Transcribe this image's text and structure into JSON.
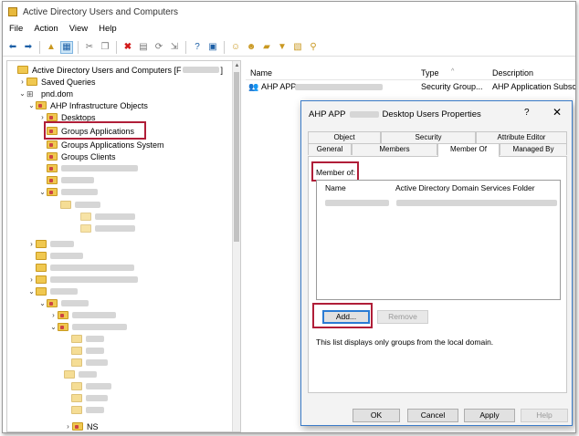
{
  "window": {
    "title": "Active Directory Users and Computers"
  },
  "menu": [
    "File",
    "Action",
    "View",
    "Help"
  ],
  "toolbar": {
    "icons": [
      "back-arrow",
      "forward-arrow",
      "up-folder",
      "console-tree",
      "cut",
      "copy",
      "delete",
      "properties",
      "refresh",
      "export",
      "help",
      "show-pane",
      "users",
      "user-add",
      "group-add",
      "filter",
      "add-to-group",
      "find"
    ]
  },
  "tree": {
    "root": "Active Directory Users and Computers [F",
    "saved_queries": "Saved Queries",
    "domain": "pnd.dom",
    "infra": "AHP Infrastructure Objects",
    "desktops": "Desktops",
    "groups_applications": "Groups Applications",
    "groups_applications_system": "Groups Applications System",
    "groups_clients": "Groups Clients",
    "ns": "NS"
  },
  "list": {
    "col_name": "Name",
    "col_type": "Type",
    "col_description": "Description",
    "row": {
      "name": "AHP APP",
      "type": "Security Group...",
      "description": "AHP Application Subsc"
    }
  },
  "dialog": {
    "title_prefix": "AHP APP",
    "title_suffix": "Desktop Users Properties",
    "help": "?",
    "close": "✕",
    "tabs_row1": [
      "Object",
      "Security",
      "Attribute Editor"
    ],
    "tabs_row2": [
      "General",
      "Members",
      "Member Of",
      "Managed By"
    ],
    "member_of_label": "Member of:",
    "member_list": {
      "col_name": "Name",
      "col_folder": "Active Directory Domain Services Folder"
    },
    "add": "Add...",
    "remove": "Remove",
    "note": "This list displays only groups from the local domain.",
    "ok": "OK",
    "cancel": "Cancel",
    "apply": "Apply",
    "help_button": "Help"
  },
  "colors": {
    "highlight": "#b01e38",
    "accent": "#2a7bd4"
  }
}
